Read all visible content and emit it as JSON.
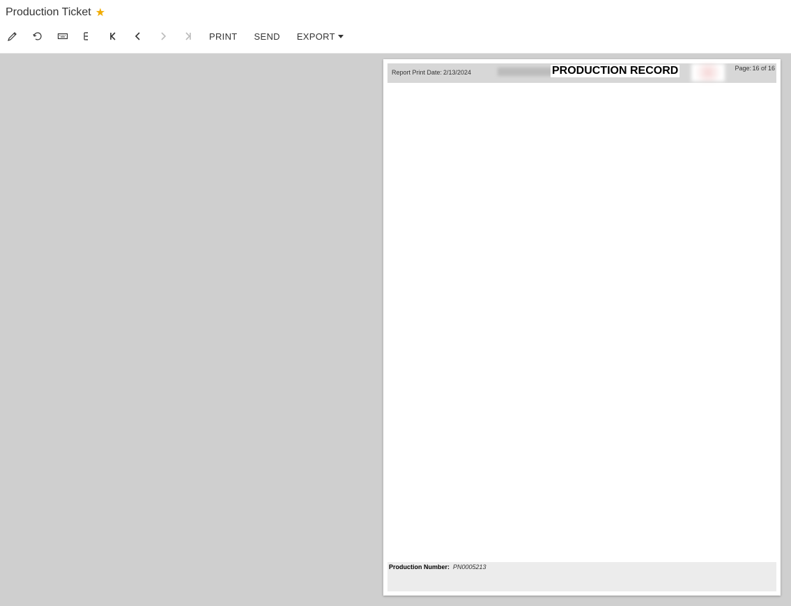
{
  "header": {
    "title": "Production Ticket"
  },
  "toolbar": {
    "print": "PRINT",
    "send": "SEND",
    "export": "EXPORT"
  },
  "report": {
    "print_date_label": "Report Print Date:",
    "print_date_value": "2/13/2024",
    "title": "PRODUCTION RECORD",
    "page_label": "Page:",
    "page_value": "16 of 16",
    "prod_num_label": "Production Number:",
    "prod_num_value": "PN0005213"
  }
}
